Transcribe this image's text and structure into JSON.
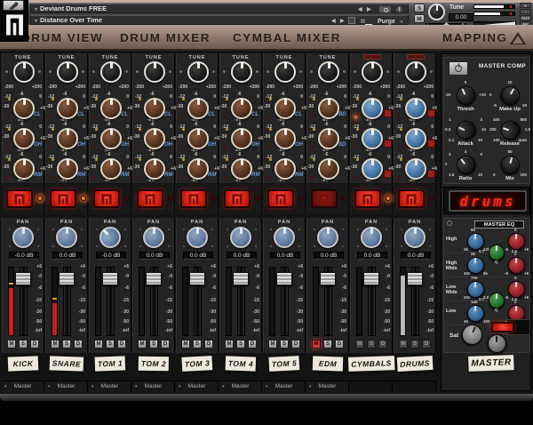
{
  "header": {
    "slot1": "Deviant Drums FREE",
    "slot2": "Distance Over Time",
    "purge": "Purge",
    "tune_label": "Tune",
    "tune_value": "0.00",
    "pan_left": "L",
    "pan_right": "R",
    "solo": "S",
    "mute": "M",
    "close": "x",
    "minimize": "-",
    "aux": "AUX",
    "pv": "PV",
    "caret": "▾",
    "arrow_left": "◀",
    "arrow_right": "▶",
    "info": "i"
  },
  "tabs": {
    "items": [
      "DRUM VIEW",
      "DRUM MIXER",
      "CYMBAL MIXER"
    ],
    "mapping": "MAPPING"
  },
  "scales": {
    "tune_label": "TUNE",
    "tune_left": "-200",
    "tune_right": "+200",
    "send": {
      "tl": "-12",
      "t": "-6",
      "tr": "0",
      "l": "-30",
      "r": "+6",
      "b": "-inf"
    },
    "fader": [
      "+6",
      "-0",
      "-6",
      "-15",
      "-30",
      "-50",
      "-inf"
    ],
    "pan_label": "PAN",
    "msd": [
      "M",
      "S",
      "D"
    ]
  },
  "display_text": "drums",
  "channels": [
    {
      "tag": "KICK",
      "sends": [
        "CL",
        "OH",
        "RM"
      ],
      "db": "-0.0 dB",
      "routing": "Master",
      "meter_pct": 70,
      "meter_color": "#c92015",
      "peak": true,
      "trigger_led": true,
      "trigger_dim": false,
      "muted": false,
      "bus": false,
      "pan_deg": 0
    },
    {
      "tag": "SNARE",
      "sends": [
        "CL",
        "OH",
        "RM"
      ],
      "db": "0.0 dB",
      "routing": "Master",
      "meter_pct": 48,
      "meter_color": "#c92015",
      "peak": true,
      "trigger_led": true,
      "trigger_dim": false,
      "muted": false,
      "bus": false,
      "pan_deg": 0
    },
    {
      "tag": "TOM 1",
      "sends": [
        "CL",
        "OH",
        "RM"
      ],
      "db": "-0.0 dB",
      "routing": "Master",
      "meter_pct": 0,
      "meter_color": "#c92015",
      "peak": false,
      "trigger_led": false,
      "trigger_dim": false,
      "muted": false,
      "bus": false,
      "pan_deg": -45
    },
    {
      "tag": "TOM 2",
      "sends": [
        "CL",
        "OH",
        "RM"
      ],
      "db": "0.0 dB",
      "routing": "Master",
      "meter_pct": 0,
      "meter_color": "#c92015",
      "peak": false,
      "trigger_led": false,
      "trigger_dim": false,
      "muted": false,
      "bus": false,
      "pan_deg": 0
    },
    {
      "tag": "TOM 3",
      "sends": [
        "CL",
        "OH",
        "RM"
      ],
      "db": "0.0 dB",
      "routing": "Master",
      "meter_pct": 0,
      "meter_color": "#c92015",
      "peak": false,
      "trigger_led": false,
      "trigger_dim": false,
      "muted": false,
      "bus": false,
      "pan_deg": 0
    },
    {
      "tag": "TOM 4",
      "sends": [
        "CL",
        "OH",
        "RM"
      ],
      "db": "0.0 dB",
      "routing": "Master",
      "meter_pct": 0,
      "meter_color": "#c92015",
      "peak": false,
      "trigger_led": false,
      "trigger_dim": false,
      "muted": false,
      "bus": false,
      "pan_deg": 0
    },
    {
      "tag": "TOM 5",
      "sends": [
        "CL",
        "OH",
        "RM"
      ],
      "db": "0.0 dB",
      "routing": "Master",
      "meter_pct": 0,
      "meter_color": "#c92015",
      "peak": false,
      "trigger_led": false,
      "trigger_dim": false,
      "muted": false,
      "bus": false,
      "pan_deg": 0
    },
    {
      "tag": "EDM",
      "sends": [
        "BD",
        "SD",
        ""
      ],
      "db": "0.0 dB",
      "routing": "Master",
      "meter_pct": 0,
      "meter_color": "#c92015",
      "peak": false,
      "trigger_led": false,
      "trigger_dim": true,
      "muted": true,
      "bus": false,
      "pan_deg": 0
    },
    {
      "tag": "CYMBALS",
      "sends": [
        "",
        "",
        ""
      ],
      "db": "0.0 dB",
      "routing": null,
      "meter_pct": 0,
      "meter_color": "#c92015",
      "peak": false,
      "trigger_led": true,
      "trigger_dim": false,
      "muted": false,
      "bus": true,
      "pan_deg": 0,
      "send_leds": [
        true,
        false,
        false
      ]
    },
    {
      "tag": "DRUMS",
      "sends": [
        "",
        "",
        ""
      ],
      "db": "0.0 dB",
      "routing": null,
      "meter_pct": 88,
      "meter_color": "#b9b9b9",
      "peak": false,
      "trigger_led": false,
      "trigger_dim": false,
      "muted": false,
      "bus": true,
      "pan_deg": 0
    }
  ],
  "master_comp": {
    "title": "MASTER COMP",
    "knobs": [
      {
        "label": "Thresh",
        "tl": "",
        "t": "0",
        "tr": "",
        "l": "-20",
        "r": "+20",
        "bl": "",
        "br": "",
        "rot": -25
      },
      {
        "label": "Make Up",
        "tl": "",
        "t": "10",
        "tr": "",
        "l": "0",
        "r": "",
        "bl": "-5",
        "br": "20",
        "rot": 30
      },
      {
        "label": "Attack",
        "tl": "1",
        "t": "",
        "tr": "3",
        "l": "0.3",
        "r": "10",
        "bl": "0.1",
        "br": "30",
        "rot": -65
      },
      {
        "label": "Release",
        "tl": "400",
        "t": "",
        "tr": "800",
        "l": "200",
        "r": "1.6",
        "bl": "100",
        "br": "auto",
        "rot": -70
      },
      {
        "label": "Ratio",
        "tl": "3",
        "t": "4",
        "tr": "5",
        "l": "2",
        "r": "",
        "bl": "1.5",
        "br": "10",
        "rot": -35
      },
      {
        "label": "Mix",
        "tl": "",
        "t": "50",
        "tr": "",
        "l": "",
        "r": "",
        "bl": "0",
        "br": "100",
        "rot": 15
      }
    ]
  },
  "master_eq": {
    "title": "MASTER EQ",
    "bands": [
      {
        "label": "High",
        "f_t": "6k",
        "f_bl": "2k",
        "f_br": "12k",
        "g_t": "0",
        "g_bl": "-6",
        "g_br": "+6"
      },
      {
        "label": "High Mids",
        "f_t": "2k",
        "f_bl": "400",
        "f_br": "6k",
        "g_t": "0",
        "g_bl": "-6",
        "g_br": "+6"
      },
      {
        "label": "Low Mids",
        "f_t": "700",
        "f_bl": "200",
        "f_br": "2.5k",
        "g_t": "0",
        "g_bl": "-6",
        "g_br": "+6"
      },
      {
        "label": "Low",
        "f_t": "140",
        "f_bl": "40",
        "f_br": "400",
        "g_t": "0",
        "g_bl": "-6",
        "g_br": "+6"
      }
    ],
    "q": {
      "l": "0.7",
      "label": "Q",
      "r": "2.5"
    },
    "sat": "Sat"
  },
  "master": {
    "tape": "MASTER"
  }
}
